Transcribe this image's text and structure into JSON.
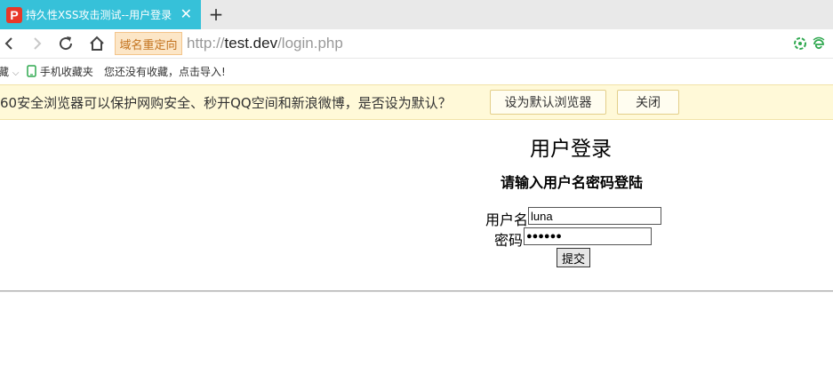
{
  "tab": {
    "logo": "P",
    "title": "持久性XSS攻击测试--用户登录",
    "close": "✕",
    "new_tab": "+"
  },
  "nav": {
    "redirect_label": "域名重定向",
    "url_scheme": "http://",
    "url_host": "test.dev",
    "url_path": "/login.php"
  },
  "bookmarks": {
    "folder_tail": "藏",
    "mobile_label": "手机收藏夹",
    "empty_text": "您还没有收藏，点击导入!"
  },
  "infobar": {
    "message": "60安全浏览器可以保护网购安全、秒开QQ空间和新浪微博，是否设为默认？",
    "set_default_label": "设为默认浏览器",
    "close_label": "关闭"
  },
  "login": {
    "title": "用户登录",
    "subtitle": "请输入用户名密码登陆",
    "username_label": "用户名",
    "username_value": "luna",
    "password_label": "密码",
    "password_value": "●●●●●●",
    "submit_label": "提交"
  },
  "colors": {
    "tab_active": "#36c1d9",
    "infobar_bg": "#fff9d8",
    "redirect_bg": "#fce6c7"
  }
}
